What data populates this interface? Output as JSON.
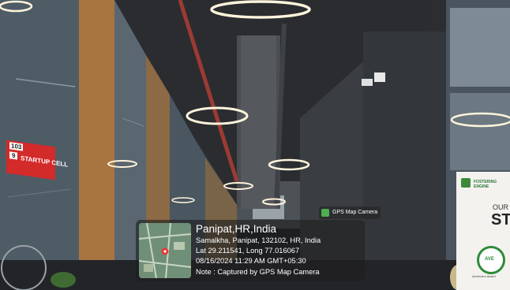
{
  "sign": {
    "room_number": "103",
    "sub_number": "9",
    "label": "STARTUP CELL"
  },
  "poster": {
    "brand": "FOSTERING ENGINE",
    "headline_small": "OUR",
    "headline_big": "ST",
    "seal": "AVE",
    "caption": "Achievers Award"
  },
  "gps_tag": {
    "label": "GPS Map Camera",
    "icon": "gps-map-camera-icon"
  },
  "gps_overlay": {
    "title": "Panipat,HR,India",
    "address": "Samalkha, Panipat, 132102, HR, India",
    "coordinates": "Lat 29.211541, Long 77.016067",
    "datetime": "08/16/2024 11:29 AM GMT+05:30",
    "note": "Note : Captured by GPS Map Camera",
    "map_pin_color": "#e53935"
  }
}
